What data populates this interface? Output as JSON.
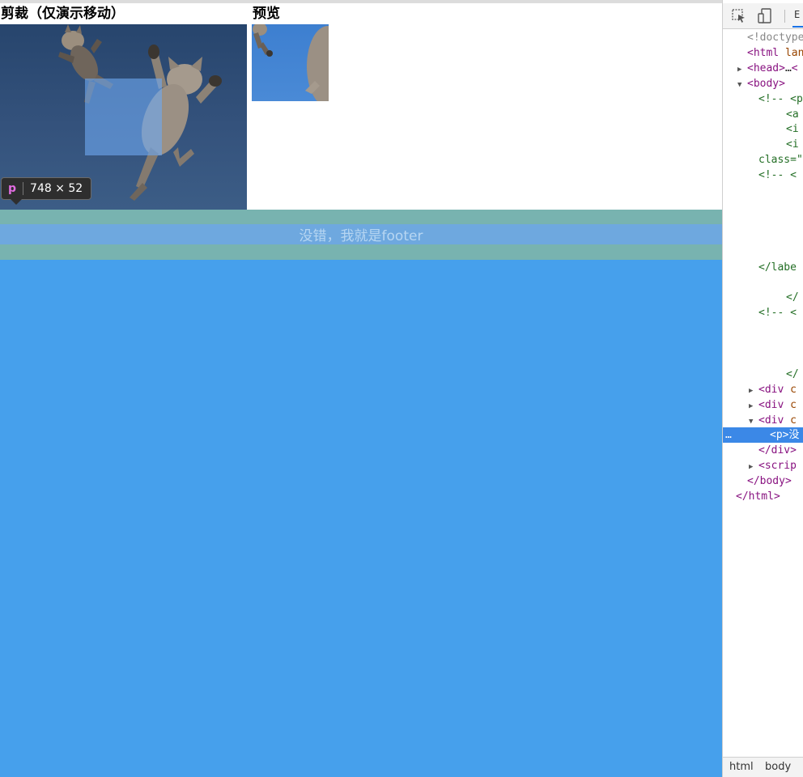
{
  "page": {
    "crop_heading": "剪裁（仅演示移动）",
    "preview_heading": "预览",
    "tooltip": {
      "tag": "p",
      "dimensions": "748 × 52"
    },
    "footer_text": "没错，我就是footer",
    "colors": {
      "footer_band": "#78b3b0",
      "footer_text_bg": "#6ea8df",
      "page_blue": "#46a0ec",
      "crop_bg": "#34527c",
      "selection": "#6da8f0"
    }
  },
  "devtools": {
    "toolbar": {
      "inspect_icon": "inspect-cursor-icon",
      "device_icon": "device-toggle-icon",
      "tab_label": "E"
    },
    "lines": [
      {
        "indent": 1,
        "arrow": "",
        "parts": [
          {
            "c": "gr",
            "t": "<!doctype"
          }
        ]
      },
      {
        "indent": 1,
        "arrow": "",
        "parts": [
          {
            "c": "tg",
            "t": "<html "
          },
          {
            "c": "at",
            "t": "lang"
          }
        ]
      },
      {
        "indent": 1,
        "arrow": "▶",
        "parts": [
          {
            "c": "tg",
            "t": "<head>"
          },
          {
            "c": "tx",
            "t": "…"
          },
          {
            "c": "tg",
            "t": "<"
          }
        ]
      },
      {
        "indent": 1,
        "arrow": "▼",
        "parts": [
          {
            "c": "tg",
            "t": "<body>"
          }
        ]
      },
      {
        "indent": 2,
        "arrow": "",
        "parts": [
          {
            "c": "cm",
            "t": "<!-- <p"
          }
        ]
      },
      {
        "indent": 4,
        "arrow": "",
        "parts": [
          {
            "c": "cm",
            "t": "<a"
          }
        ]
      },
      {
        "indent": 4,
        "arrow": "",
        "parts": [
          {
            "c": "cm",
            "t": "<i"
          }
        ]
      },
      {
        "indent": 4,
        "arrow": "",
        "parts": [
          {
            "c": "cm",
            "t": "<i"
          }
        ]
      },
      {
        "indent": 2,
        "arrow": "",
        "parts": [
          {
            "c": "cm",
            "t": "class=\""
          }
        ]
      },
      {
        "indent": 2,
        "arrow": "",
        "parts": [
          {
            "c": "cm",
            "t": "<!-- <"
          }
        ]
      },
      {
        "indent": 2,
        "arrow": "",
        "parts": [
          {
            "c": "cm",
            "t": ""
          }
        ]
      },
      {
        "indent": 2,
        "arrow": "",
        "parts": [
          {
            "c": "cm",
            "t": ""
          }
        ]
      },
      {
        "indent": 2,
        "arrow": "",
        "parts": [
          {
            "c": "cm",
            "t": ""
          }
        ]
      },
      {
        "indent": 2,
        "arrow": "",
        "parts": [
          {
            "c": "cm",
            "t": ""
          }
        ]
      },
      {
        "indent": 2,
        "arrow": "",
        "parts": [
          {
            "c": "cm",
            "t": ""
          }
        ]
      },
      {
        "indent": 2,
        "arrow": "",
        "parts": [
          {
            "c": "cm",
            "t": "</labe"
          }
        ]
      },
      {
        "indent": 2,
        "arrow": "",
        "parts": [
          {
            "c": "cm",
            "t": ""
          }
        ]
      },
      {
        "indent": 4,
        "arrow": "",
        "parts": [
          {
            "c": "cm",
            "t": "</"
          }
        ]
      },
      {
        "indent": 2,
        "arrow": "",
        "parts": [
          {
            "c": "cm",
            "t": "<!-- <"
          }
        ]
      },
      {
        "indent": 2,
        "arrow": "",
        "parts": [
          {
            "c": "cm",
            "t": ""
          }
        ]
      },
      {
        "indent": 2,
        "arrow": "",
        "parts": [
          {
            "c": "cm",
            "t": ""
          }
        ]
      },
      {
        "indent": 2,
        "arrow": "",
        "parts": [
          {
            "c": "cm",
            "t": ""
          }
        ]
      },
      {
        "indent": 4,
        "arrow": "",
        "parts": [
          {
            "c": "cm",
            "t": "</"
          }
        ]
      },
      {
        "indent": 2,
        "arrow": "▶",
        "parts": [
          {
            "c": "tg",
            "t": "<div "
          },
          {
            "c": "at",
            "t": "c"
          }
        ]
      },
      {
        "indent": 2,
        "arrow": "▶",
        "parts": [
          {
            "c": "tg",
            "t": "<div "
          },
          {
            "c": "at",
            "t": "c"
          }
        ]
      },
      {
        "indent": 2,
        "arrow": "▼",
        "parts": [
          {
            "c": "tg",
            "t": "<div "
          },
          {
            "c": "at",
            "t": "c"
          }
        ]
      },
      {
        "indent": 3,
        "arrow": "",
        "selected": true,
        "parts": [
          {
            "c": "tg",
            "t": "<p>"
          },
          {
            "c": "tx",
            "t": "没"
          }
        ]
      },
      {
        "indent": 2,
        "arrow": "",
        "parts": [
          {
            "c": "tg",
            "t": "</div>"
          }
        ]
      },
      {
        "indent": 2,
        "arrow": "▶",
        "parts": [
          {
            "c": "tg",
            "t": "<scrip"
          }
        ]
      },
      {
        "indent": 1,
        "arrow": "",
        "parts": [
          {
            "c": "tg",
            "t": "</body>"
          }
        ]
      },
      {
        "indent": 0,
        "arrow": "",
        "parts": [
          {
            "c": "tg",
            "t": "</html>"
          }
        ]
      }
    ],
    "selected_marker": "…",
    "breadcrumbs": [
      "html",
      "body"
    ]
  }
}
